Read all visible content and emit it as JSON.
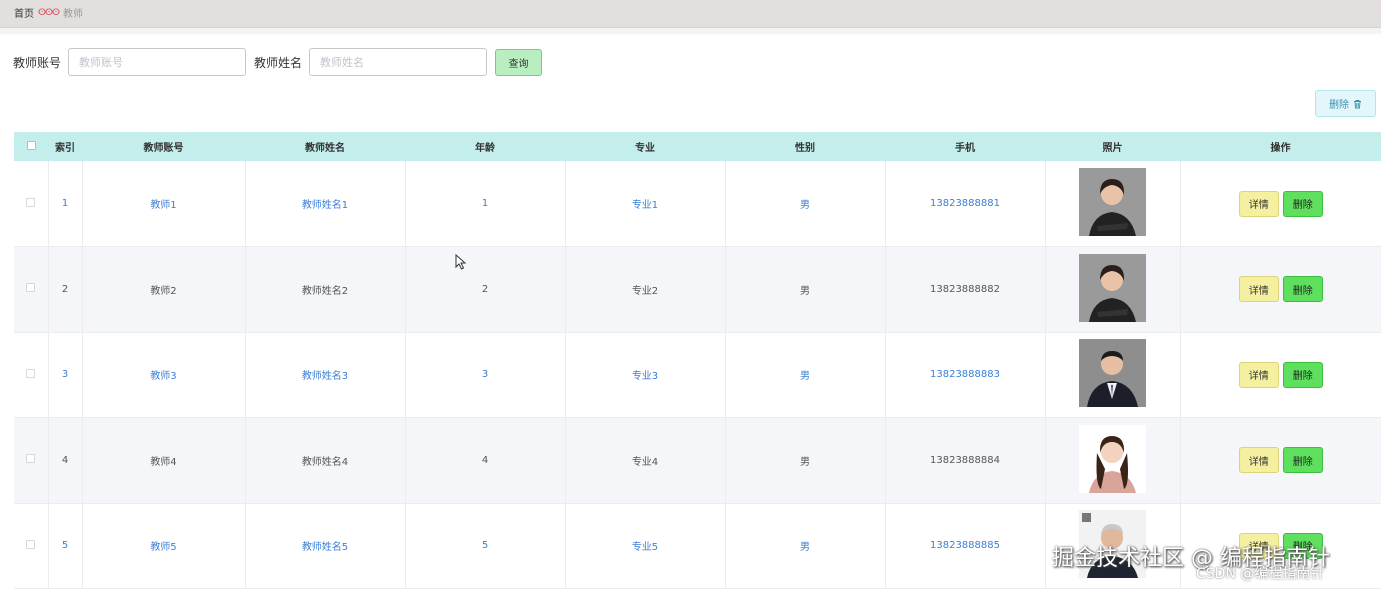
{
  "breadcrumb": {
    "home": "首页",
    "separator": "ⵙⵙⵙ",
    "current": "教师"
  },
  "search": {
    "account_label": "教师账号",
    "account_placeholder": "教师账号",
    "name_label": "教师姓名",
    "name_placeholder": "教师姓名",
    "query_label": "查询"
  },
  "toolbar": {
    "bulk_delete_label": "删除",
    "bulk_delete_icon": "trash-icon"
  },
  "table": {
    "headers": [
      "索引",
      "教师账号",
      "教师姓名",
      "年龄",
      "专业",
      "性别",
      "手机",
      "照片",
      "操作"
    ],
    "rows": [
      {
        "index": "1",
        "account": "教师1",
        "name": "教师姓名1",
        "age": "1",
        "major": "专业1",
        "gender": "男",
        "phone": "13823888881"
      },
      {
        "index": "2",
        "account": "教师2",
        "name": "教师姓名2",
        "age": "2",
        "major": "专业2",
        "gender": "男",
        "phone": "13823888882"
      },
      {
        "index": "3",
        "account": "教师3",
        "name": "教师姓名3",
        "age": "3",
        "major": "专业3",
        "gender": "男",
        "phone": "13823888883"
      },
      {
        "index": "4",
        "account": "教师4",
        "name": "教师姓名4",
        "age": "4",
        "major": "专业4",
        "gender": "男",
        "phone": "13823888884"
      },
      {
        "index": "5",
        "account": "教师5",
        "name": "教师姓名5",
        "age": "5",
        "major": "专业5",
        "gender": "男",
        "phone": "13823888885"
      }
    ],
    "detail_label": "详情",
    "delete_label": "删除"
  },
  "watermark": {
    "main": "掘金技术社区 @ 编程指南针",
    "sub": "CSDN @编程指南针"
  },
  "colors": {
    "header_bg": "#c3eeec",
    "link": "#3b7fd6",
    "query_btn": "#b8eec0",
    "detail_btn": "#f5f0a0",
    "delete_btn": "#5ee05e"
  }
}
